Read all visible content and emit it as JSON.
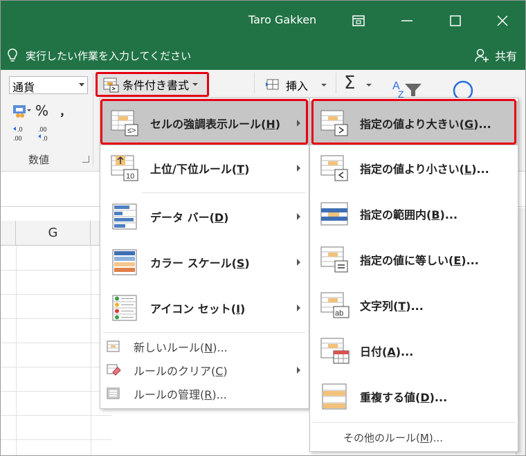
{
  "window": {
    "user": "Taro Gakken"
  },
  "tellme": {
    "placeholder": "実行したい作業を入力してください",
    "share_label": "共有"
  },
  "ribbon": {
    "number_format": "通貨",
    "percent": "%",
    "comma": "，",
    "number_group_label": "数値",
    "conditional_formatting": "条件付き書式",
    "insert": "挿入",
    "sigma": "Σ"
  },
  "sheet": {
    "column": "G"
  },
  "menu_main": {
    "items": [
      {
        "label": "セルの強調表示ルール(",
        "key": "H",
        "end": ")"
      },
      {
        "label": "上位/下位ルール(",
        "key": "T",
        "end": ")"
      },
      {
        "label": "データ バー(",
        "key": "D",
        "end": ")"
      },
      {
        "label": "カラー スケール(",
        "key": "S",
        "end": ")"
      },
      {
        "label": "アイコン セット(",
        "key": "I",
        "end": ")"
      }
    ],
    "small_items": [
      {
        "label": "新しいルール(",
        "key": "N",
        "end": ")..."
      },
      {
        "label": "ルールのクリア(",
        "key": "C",
        "end": ")"
      },
      {
        "label": "ルールの管理(",
        "key": "R",
        "end": ")..."
      }
    ]
  },
  "menu_sub": {
    "items": [
      {
        "label": "指定の値より大きい(",
        "key": "G",
        "end": ")..."
      },
      {
        "label": "指定の値より小さい(",
        "key": "L",
        "end": ")..."
      },
      {
        "label": "指定の範囲内(",
        "key": "B",
        "end": ")..."
      },
      {
        "label": "指定の値に等しい(",
        "key": "E",
        "end": ")..."
      },
      {
        "label": "文字列(",
        "key": "T",
        "end": ")..."
      },
      {
        "label": "日付(",
        "key": "A",
        "end": ")..."
      },
      {
        "label": "重複する値(",
        "key": "D",
        "end": ")..."
      }
    ],
    "more_rules": {
      "label": "その他のルール(",
      "key": "M",
      "end": ")..."
    }
  },
  "colors": {
    "excel_green": "#217346",
    "highlight_red": "#e60012",
    "menu_hover": "#c6c6c6"
  }
}
